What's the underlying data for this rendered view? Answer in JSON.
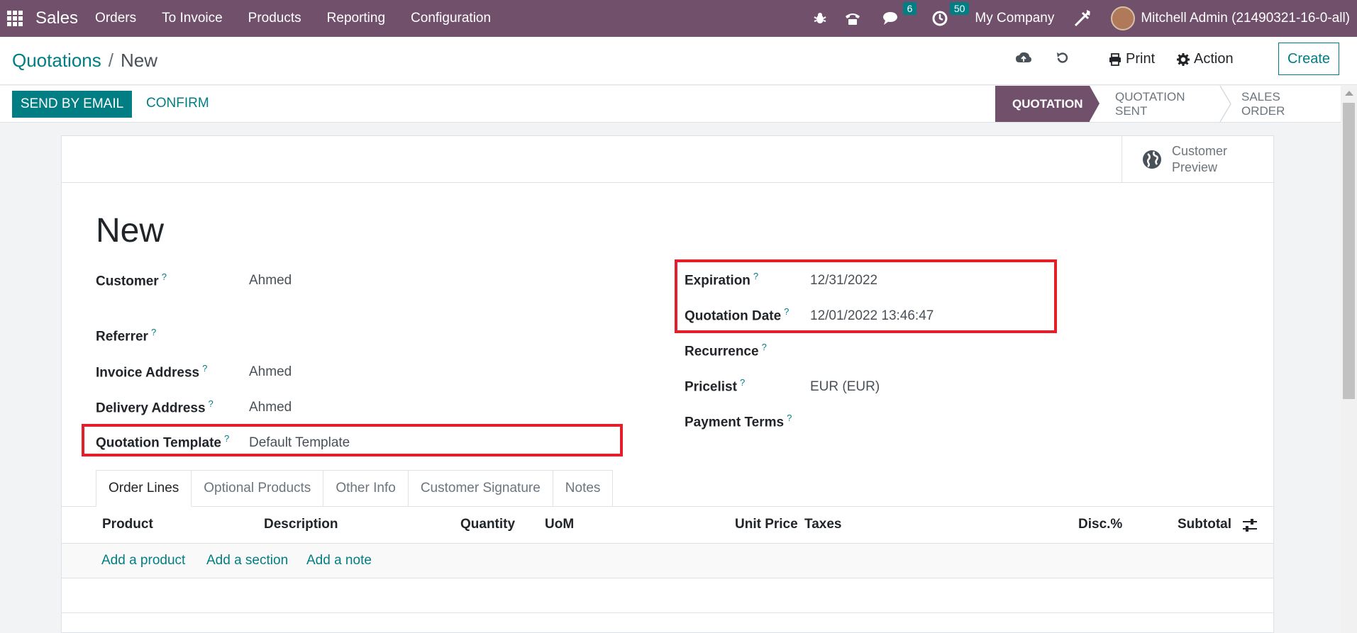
{
  "navbar": {
    "app_name": "Sales",
    "menu": [
      "Orders",
      "To Invoice",
      "Products",
      "Reporting",
      "Configuration"
    ],
    "messages_count": "6",
    "activities_count": "50",
    "company": "My Company",
    "user": "Mitchell Admin (21490321-16-0-all)"
  },
  "breadcrumb": {
    "parent": "Quotations",
    "separator": "/",
    "current": "New"
  },
  "control_panel": {
    "print_label": "Print",
    "action_label": "Action",
    "create_label": "Create"
  },
  "statusbar": {
    "send_email_label": "SEND BY EMAIL",
    "confirm_label": "CONFIRM",
    "stages": [
      "QUOTATION",
      "QUOTATION SENT",
      "SALES ORDER"
    ],
    "active_stage": "QUOTATION"
  },
  "sheet": {
    "preview_line1": "Customer",
    "preview_line2": "Preview",
    "title": "New",
    "help_mark": "?",
    "left_fields": {
      "customer": {
        "label": "Customer",
        "value": "Ahmed"
      },
      "referrer": {
        "label": "Referrer",
        "value": ""
      },
      "invoice_address": {
        "label": "Invoice Address",
        "value": "Ahmed"
      },
      "delivery_address": {
        "label": "Delivery Address",
        "value": "Ahmed"
      },
      "quotation_template": {
        "label": "Quotation Template",
        "value": "Default Template"
      }
    },
    "right_fields": {
      "expiration": {
        "label": "Expiration",
        "value": "12/31/2022"
      },
      "quotation_date": {
        "label": "Quotation Date",
        "value": "12/01/2022 13:46:47"
      },
      "recurrence": {
        "label": "Recurrence",
        "value": ""
      },
      "pricelist": {
        "label": "Pricelist",
        "value": "EUR (EUR)"
      },
      "payment_terms": {
        "label": "Payment Terms",
        "value": ""
      }
    },
    "tabs": [
      "Order Lines",
      "Optional Products",
      "Other Info",
      "Customer Signature",
      "Notes"
    ],
    "active_tab": "Order Lines",
    "columns": [
      "Product",
      "Description",
      "Quantity",
      "UoM",
      "Unit Price",
      "Taxes",
      "Disc.%",
      "Subtotal"
    ],
    "add_links": [
      "Add a product",
      "Add a section",
      "Add a note"
    ]
  },
  "colors": {
    "brand": "#71506c",
    "accent": "#017e84",
    "highlight": "#e41f2c"
  }
}
